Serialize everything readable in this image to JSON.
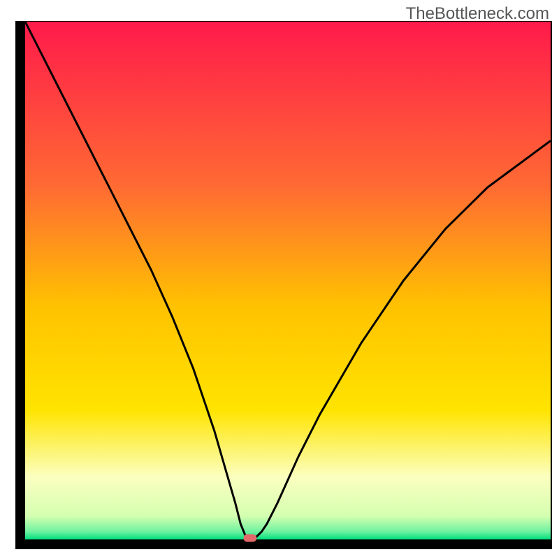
{
  "watermark": "TheBottleneck.com",
  "chart_data": {
    "type": "line",
    "title": "",
    "xlabel": "",
    "ylabel": "",
    "xlim": [
      0,
      100
    ],
    "ylim": [
      0,
      100
    ],
    "background_gradient": {
      "top": "#ff1a4b",
      "mid1": "#ff8a2c",
      "mid2": "#ffe400",
      "pale": "#fbffc0",
      "bottom": "#00dd7b"
    },
    "series": [
      {
        "name": "bottleneck-curve",
        "x": [
          0,
          4,
          8,
          12,
          16,
          20,
          24,
          28,
          32,
          34,
          36,
          38,
          40,
          41,
          42,
          42.5,
          43,
          44,
          45,
          46,
          48,
          52,
          56,
          60,
          64,
          68,
          72,
          76,
          80,
          84,
          88,
          92,
          96,
          100
        ],
        "y": [
          100,
          92,
          84,
          76,
          68,
          60,
          52,
          43,
          33,
          27,
          21,
          14,
          7,
          3,
          0.5,
          0,
          0,
          0.5,
          1.5,
          3,
          7,
          16,
          24,
          31,
          38,
          44,
          50,
          55,
          60,
          64,
          68,
          71,
          74,
          77
        ]
      }
    ],
    "marker": {
      "x": 42.8,
      "y": 0,
      "color": "#e26a6a",
      "width": 2.5,
      "height": 1.5
    }
  }
}
